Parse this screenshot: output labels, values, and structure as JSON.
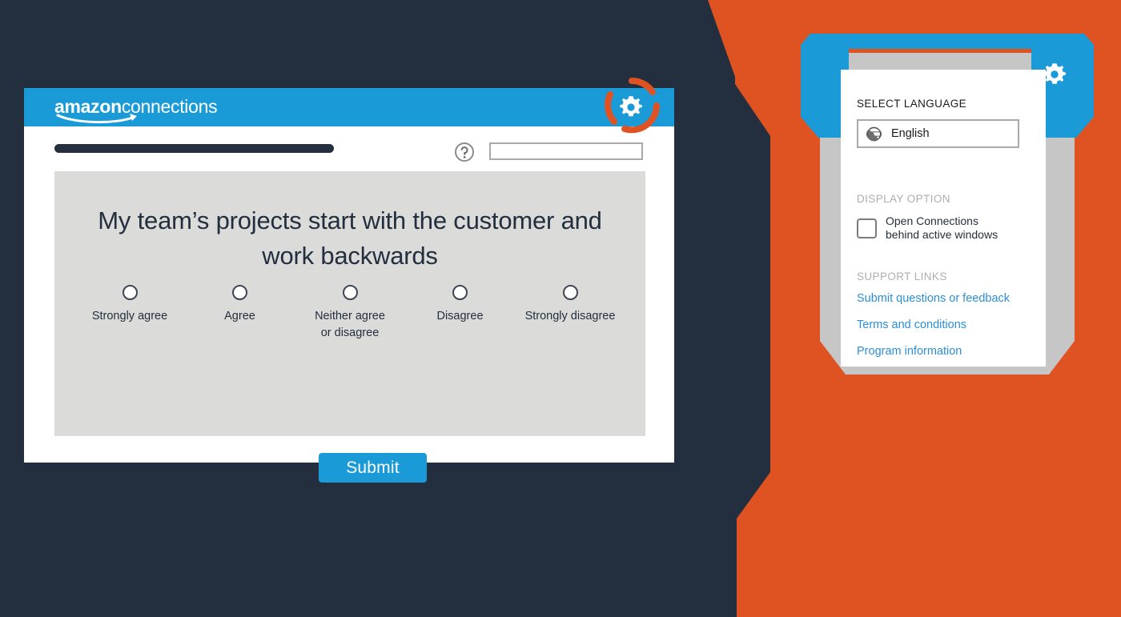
{
  "colors": {
    "background_navy": "#232F3E",
    "accent_orange": "#DF5222",
    "brand_blue": "#1A9BD7",
    "panel_gray": "#C6C6C6",
    "survey_gray": "#DBDBD9",
    "link_blue": "#2B8FD8"
  },
  "app_window": {
    "brand_bold": "amazon",
    "brand_light": "connections",
    "gear_icon": "gear-icon",
    "help_icon": "question-mark-circle-icon",
    "search_value": "",
    "search_placeholder": ""
  },
  "survey": {
    "question": "My team’s projects start with the customer and work backwards",
    "options": [
      {
        "label": "Strongly agree",
        "selected": false
      },
      {
        "label": "Agree",
        "selected": false
      },
      {
        "label": "Neither agree\nor disagree",
        "selected": false
      },
      {
        "label": "Disagree",
        "selected": false
      },
      {
        "label": "Strongly disagree",
        "selected": false
      }
    ],
    "submit_label": "Submit"
  },
  "settings_panel": {
    "gear_icon": "gear-icon",
    "language": {
      "section_title": "SELECT LANGUAGE",
      "icon": "globe-icon",
      "selected": "English"
    },
    "display_option": {
      "section_title": "DISPLAY OPTION",
      "checkbox_label": "Open Connections\nbehind active windows",
      "checked": false
    },
    "support_links": {
      "section_title": "SUPPORT LINKS",
      "links": [
        "Submit questions or feedback",
        "Terms and conditions",
        "Program information"
      ]
    }
  }
}
